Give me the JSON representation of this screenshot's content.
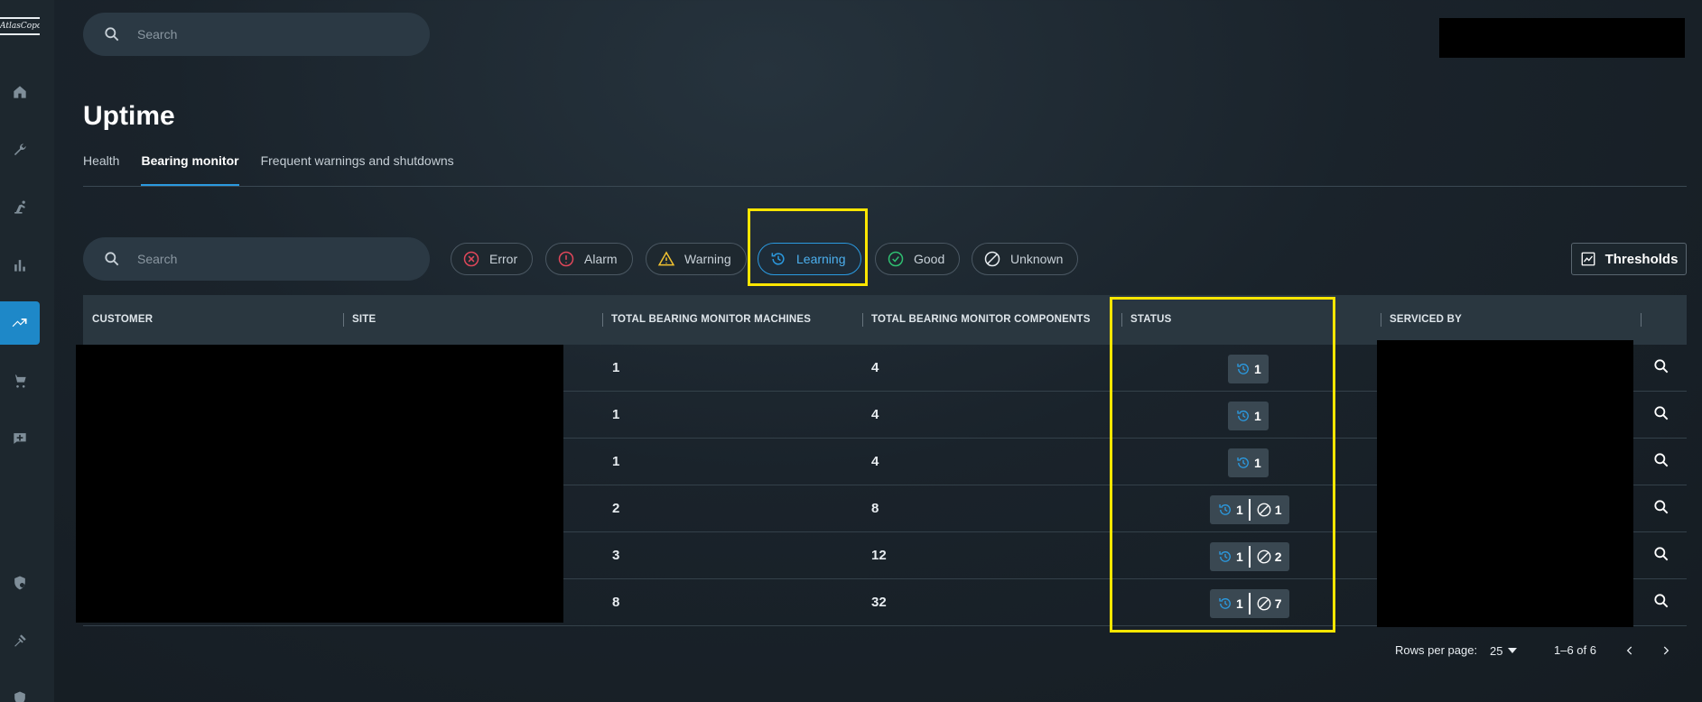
{
  "app": {
    "logo_text": "AtlasCopco",
    "search_placeholder": "Search"
  },
  "rail": {
    "items": [
      {
        "icon": "home-icon"
      },
      {
        "icon": "wrench-icon"
      },
      {
        "icon": "robot-arm-icon"
      },
      {
        "icon": "bar-chart-icon"
      },
      {
        "icon": "trend-icon",
        "active": true
      },
      {
        "icon": "cart-icon"
      },
      {
        "icon": "message-add-icon"
      },
      {
        "icon": "shield-gear-icon"
      },
      {
        "icon": "tools-icon"
      },
      {
        "icon": "more-icon"
      }
    ]
  },
  "page": {
    "title": "Uptime",
    "tabs": [
      {
        "label": "Health",
        "active": false
      },
      {
        "label": "Bearing monitor",
        "active": true
      },
      {
        "label": "Frequent warnings and shutdowns",
        "active": false
      }
    ]
  },
  "filters": {
    "search_placeholder": "Search",
    "chips": [
      {
        "label": "Error",
        "icon": "error-circle-icon",
        "color": "#e0475a"
      },
      {
        "label": "Alarm",
        "icon": "alarm-circle-icon",
        "color": "#e0475a"
      },
      {
        "label": "Warning",
        "icon": "warning-triangle-icon",
        "color": "#f2c230"
      },
      {
        "label": "Learning",
        "icon": "learning-history-icon",
        "color": "#2b9ae0",
        "selected": true
      },
      {
        "label": "Good",
        "icon": "good-check-icon",
        "color": "#2fbf71"
      },
      {
        "label": "Unknown",
        "icon": "unknown-slash-icon",
        "color": "#e8edf1"
      }
    ],
    "thresholds_label": "Thresholds"
  },
  "table": {
    "columns": [
      "CUSTOMER",
      "SITE",
      "TOTAL BEARING MONITOR MACHINES",
      "TOTAL BEARING MONITOR COMPONENTS",
      "STATUS",
      "SERVICED BY"
    ],
    "rows": [
      {
        "machines": "1",
        "components": "4",
        "learning": "1",
        "unknown": null
      },
      {
        "machines": "1",
        "components": "4",
        "learning": "1",
        "unknown": null
      },
      {
        "machines": "1",
        "components": "4",
        "learning": "1",
        "unknown": null
      },
      {
        "machines": "2",
        "components": "8",
        "learning": "1",
        "unknown": "1"
      },
      {
        "machines": "3",
        "components": "12",
        "learning": "1",
        "unknown": "2"
      },
      {
        "machines": "8",
        "components": "32",
        "learning": "1",
        "unknown": "7"
      }
    ]
  },
  "pagination": {
    "rows_per_page_label": "Rows per page:",
    "rows_per_page_value": "25",
    "range_text": "1–6 of 6"
  },
  "colors": {
    "accent": "#2b9ae0",
    "highlight": "#ffe600"
  }
}
